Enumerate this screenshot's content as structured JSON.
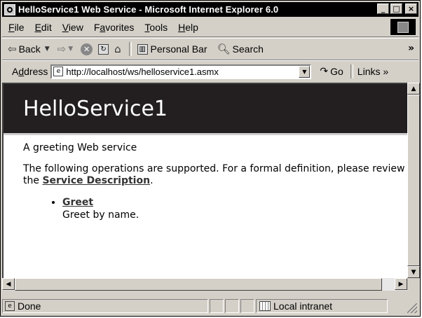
{
  "window": {
    "title": "HelloService1 Web Service - Microsoft Internet Explorer 6.0",
    "minimize_label": "_",
    "maximize_label": "□",
    "close_label": "×"
  },
  "menubar": {
    "items": [
      {
        "accel": "F",
        "rest": "ile"
      },
      {
        "accel": "E",
        "rest": "dit"
      },
      {
        "accel": "V",
        "rest": "iew"
      },
      {
        "pre": "F",
        "accel": "a",
        "rest": "vorites"
      },
      {
        "accel": "T",
        "rest": "ools"
      },
      {
        "accel": "H",
        "rest": "elp"
      }
    ]
  },
  "toolbar": {
    "back_label": "Back",
    "personal_bar_label": "Personal Bar",
    "search_label": "Search",
    "overflow": "»"
  },
  "address": {
    "label_accel": "d",
    "label_pre": "A",
    "label_rest": "dress",
    "url": "http://localhost/ws/helloservice1.asmx",
    "go_label": "Go",
    "links_label": "Links »"
  },
  "page": {
    "heading": "HelloService1",
    "description": "A greeting Web service",
    "ops_intro_pre": "The following operations are supported. For a formal definition, please review the ",
    "service_description_link": "Service Description",
    "ops_intro_post": ".",
    "operations": [
      {
        "name": "Greet",
        "description": "Greet by name."
      }
    ]
  },
  "status": {
    "text": "Done",
    "zone": "Local intranet"
  }
}
